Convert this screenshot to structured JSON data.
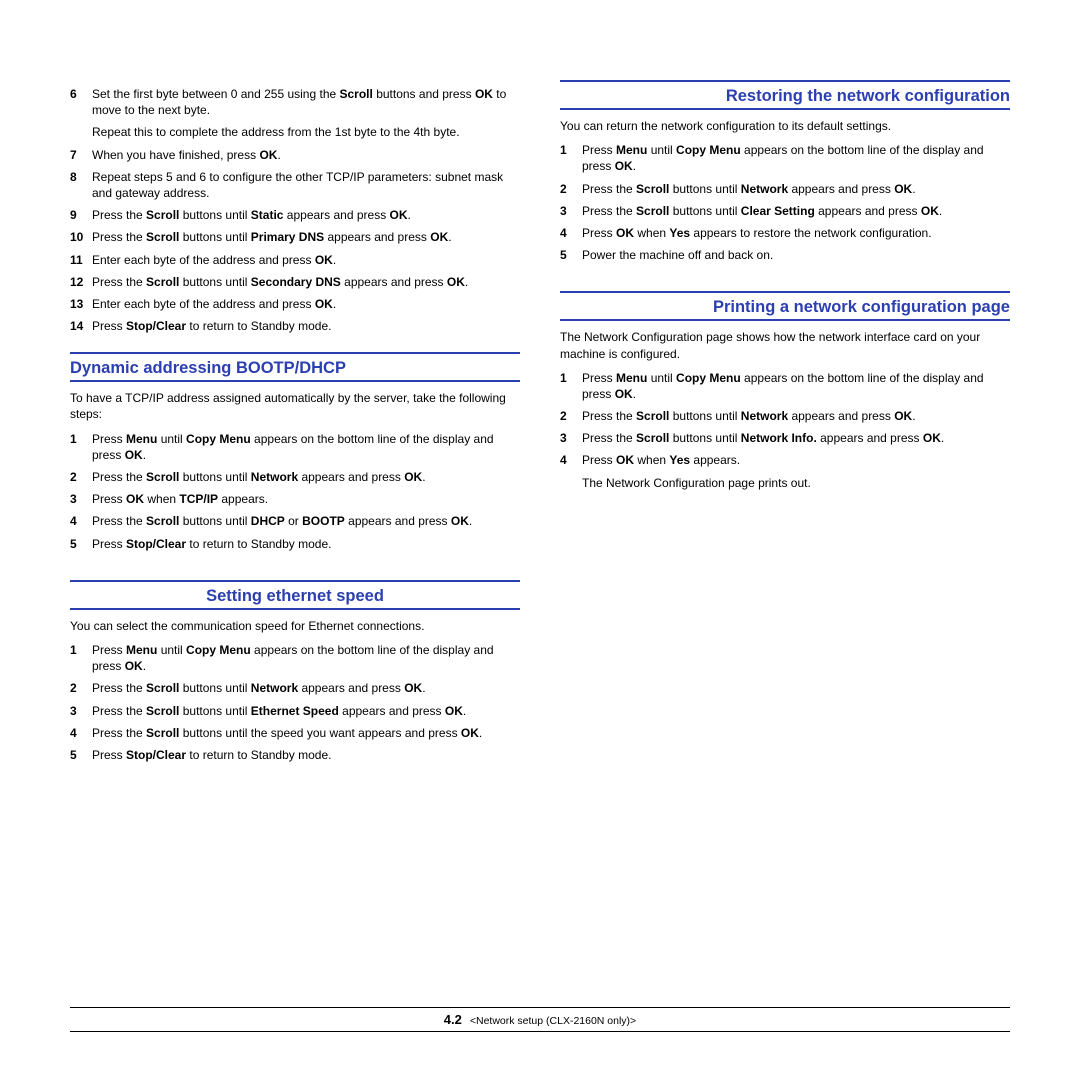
{
  "left": {
    "continued_steps": [
      {
        "n": "6",
        "html": "Set the first byte between 0 and 255 using the <b>Scroll</b> buttons and press <b>OK</b> to move to the next byte.",
        "sub": "Repeat this to complete the address from the 1st byte to the 4th byte."
      },
      {
        "n": "7",
        "html": "When you have finished, press <b>OK</b>."
      },
      {
        "n": "8",
        "html": "Repeat steps 5 and 6 to configure the other TCP/IP parameters: subnet mask and gateway address."
      },
      {
        "n": "9",
        "html": "Press the <b>Scroll</b> buttons until <b>Static</b> appears and press <b>OK</b>."
      },
      {
        "n": "10",
        "html": "Press the <b>Scroll</b> buttons until <b>Primary DNS</b> appears and press <b>OK</b>."
      },
      {
        "n": "11",
        "html": "Enter each byte of the address and press <b>OK</b>."
      },
      {
        "n": "12",
        "html": "Press the <b>Scroll</b> buttons until <b>Secondary DNS</b> appears and press <b>OK</b>."
      },
      {
        "n": "13",
        "html": "Enter each byte of the address and press <b>OK</b>."
      },
      {
        "n": "14",
        "html": "Press <b>Stop/Clear</b> to return to Standby mode."
      }
    ],
    "sec1": {
      "heading": "Dynamic addressing BOOTP/DHCP",
      "intro": "To have a TCP/IP address assigned automatically by the server, take the following steps:",
      "steps": [
        {
          "n": "1",
          "html": "Press <b>Menu</b> until <b>Copy Menu</b> appears on the bottom line of the display and press <b>OK</b>."
        },
        {
          "n": "2",
          "html": "Press the <b>Scroll</b> buttons until <b>Network</b> appears and press <b>OK</b>."
        },
        {
          "n": "3",
          "html": "Press <b>OK</b> when <b>TCP/IP</b> appears."
        },
        {
          "n": "4",
          "html": "Press the <b>Scroll</b> buttons until <b>DHCP</b> or <b>BOOTP</b> appears and press <b>OK</b>."
        },
        {
          "n": "5",
          "html": "Press <b>Stop/Clear</b> to return to Standby mode."
        }
      ]
    },
    "sec2": {
      "heading": "Setting ethernet speed",
      "intro": "You can select the communication speed for Ethernet connections.",
      "steps": [
        {
          "n": "1",
          "html": "Press <b>Menu</b> until <b>Copy Menu</b> appears on the bottom line of the display and press <b>OK</b>."
        },
        {
          "n": "2",
          "html": "Press the <b>Scroll</b> buttons until <b>Network</b> appears and press <b>OK</b>."
        },
        {
          "n": "3",
          "html": "Press the <b>Scroll</b> buttons until <b>Ethernet Speed</b> appears and press <b>OK</b>."
        },
        {
          "n": "4",
          "html": "Press the <b>Scroll</b> buttons until the speed you want appears and press <b>OK</b>."
        },
        {
          "n": "5",
          "html": "Press <b>Stop/Clear</b> to return to Standby mode."
        }
      ]
    }
  },
  "right": {
    "sec1": {
      "heading": "Restoring the network configuration",
      "intro": "You can return the network configuration to its default settings.",
      "steps": [
        {
          "n": "1",
          "html": "Press <b>Menu</b> until <b>Copy Menu</b> appears on the bottom line of the display and press <b>OK</b>."
        },
        {
          "n": "2",
          "html": "Press the <b>Scroll</b> buttons until <b>Network</b> appears and press <b>OK</b>."
        },
        {
          "n": "3",
          "html": "Press the <b>Scroll</b> buttons until <b>Clear Setting</b> appears and press <b>OK</b>."
        },
        {
          "n": "4",
          "html": "Press <b>OK</b> when <b>Yes</b> appears to restore the network configuration."
        },
        {
          "n": "5",
          "html": "Power the machine off and back on."
        }
      ]
    },
    "sec2": {
      "heading": "Printing a network configuration page",
      "intro": "The Network Configuration page shows how the network interface card on your machine is configured.",
      "steps": [
        {
          "n": "1",
          "html": "Press <b>Menu</b> until <b>Copy Menu</b> appears on the bottom line of the display and press <b>OK</b>."
        },
        {
          "n": "2",
          "html": "Press the <b>Scroll</b> buttons until <b>Network</b> appears and press <b>OK</b>."
        },
        {
          "n": "3",
          "html": "Press the <b>Scroll</b> buttons until <b>Network Info.</b> appears and press <b>OK</b>."
        },
        {
          "n": "4",
          "html": "Press <b>OK</b> when <b>Yes</b> appears.",
          "sub": "The Network Configuration page prints out."
        }
      ]
    }
  },
  "footer": {
    "page_num": "4.2",
    "page_label": "<Network setup (CLX-2160N only)>"
  }
}
